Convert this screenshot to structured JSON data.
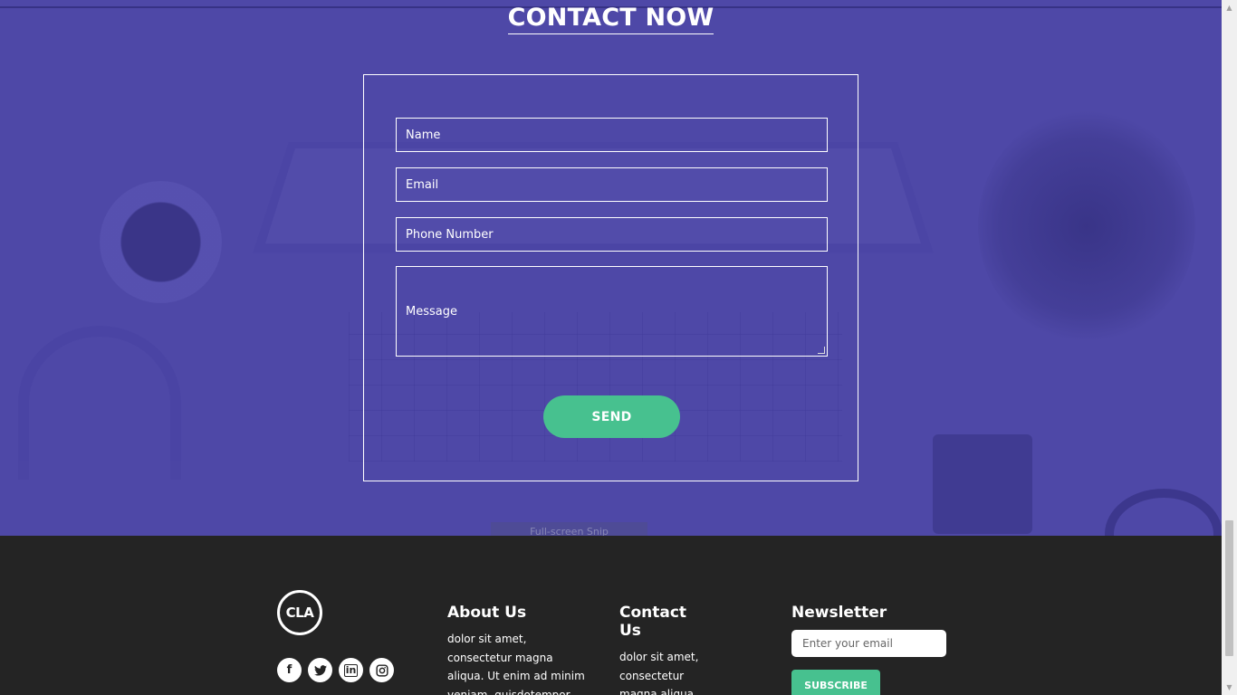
{
  "contact": {
    "title": "CONTACT NOW",
    "fields": {
      "name_placeholder": "Name",
      "email_placeholder": "Email",
      "phone_placeholder": "Phone Number",
      "message_placeholder": "Message"
    },
    "send_label": "SEND"
  },
  "overlay": {
    "snip_label": "Full-screen Snip"
  },
  "footer": {
    "logo_text": "CLA",
    "socials": [
      {
        "icon": "facebook-icon",
        "glyph": "f"
      },
      {
        "icon": "twitter-icon",
        "glyph": "t"
      },
      {
        "icon": "linkedin-icon",
        "glyph": "in"
      },
      {
        "icon": "instagram-icon",
        "glyph": "◎"
      }
    ],
    "about": {
      "heading": "About Us",
      "text": "dolor sit amet, consectetur magna aliqua. Ut enim ad minim veniam, quisdotempor incididunt r"
    },
    "contact": {
      "heading": "Contact Us",
      "text": "dolor sit amet, consectetur magna aliqua. quisdotempor"
    },
    "newsletter": {
      "heading": "Newsletter",
      "email_placeholder": "Enter your email",
      "subscribe_label": "SUBSCRIBE"
    }
  },
  "colors": {
    "contact_bg": "#4e48a7",
    "footer_bg": "#242424",
    "accent": "#47c18f"
  }
}
